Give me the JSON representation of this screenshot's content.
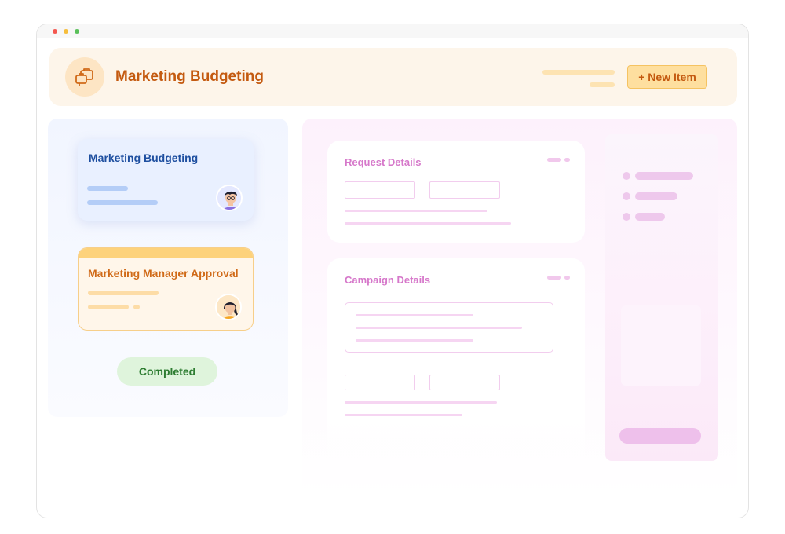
{
  "header": {
    "app_title": "Marketing Budgeting",
    "app_icon": "briefcase-stack-icon",
    "new_item_label": "+ New Item"
  },
  "workflow": {
    "step1_title": "Marketing Budgeting",
    "step2_title": "Marketing Manager Approval",
    "status_label": "Completed"
  },
  "form": {
    "request_details_title": "Request Details",
    "campaign_details_title": "Campaign Details"
  },
  "colors": {
    "brand_orange": "#c45a10",
    "accent_pink": "#d678ca",
    "step_blue": "#1e4fa0",
    "status_green": "#2e7d32"
  }
}
